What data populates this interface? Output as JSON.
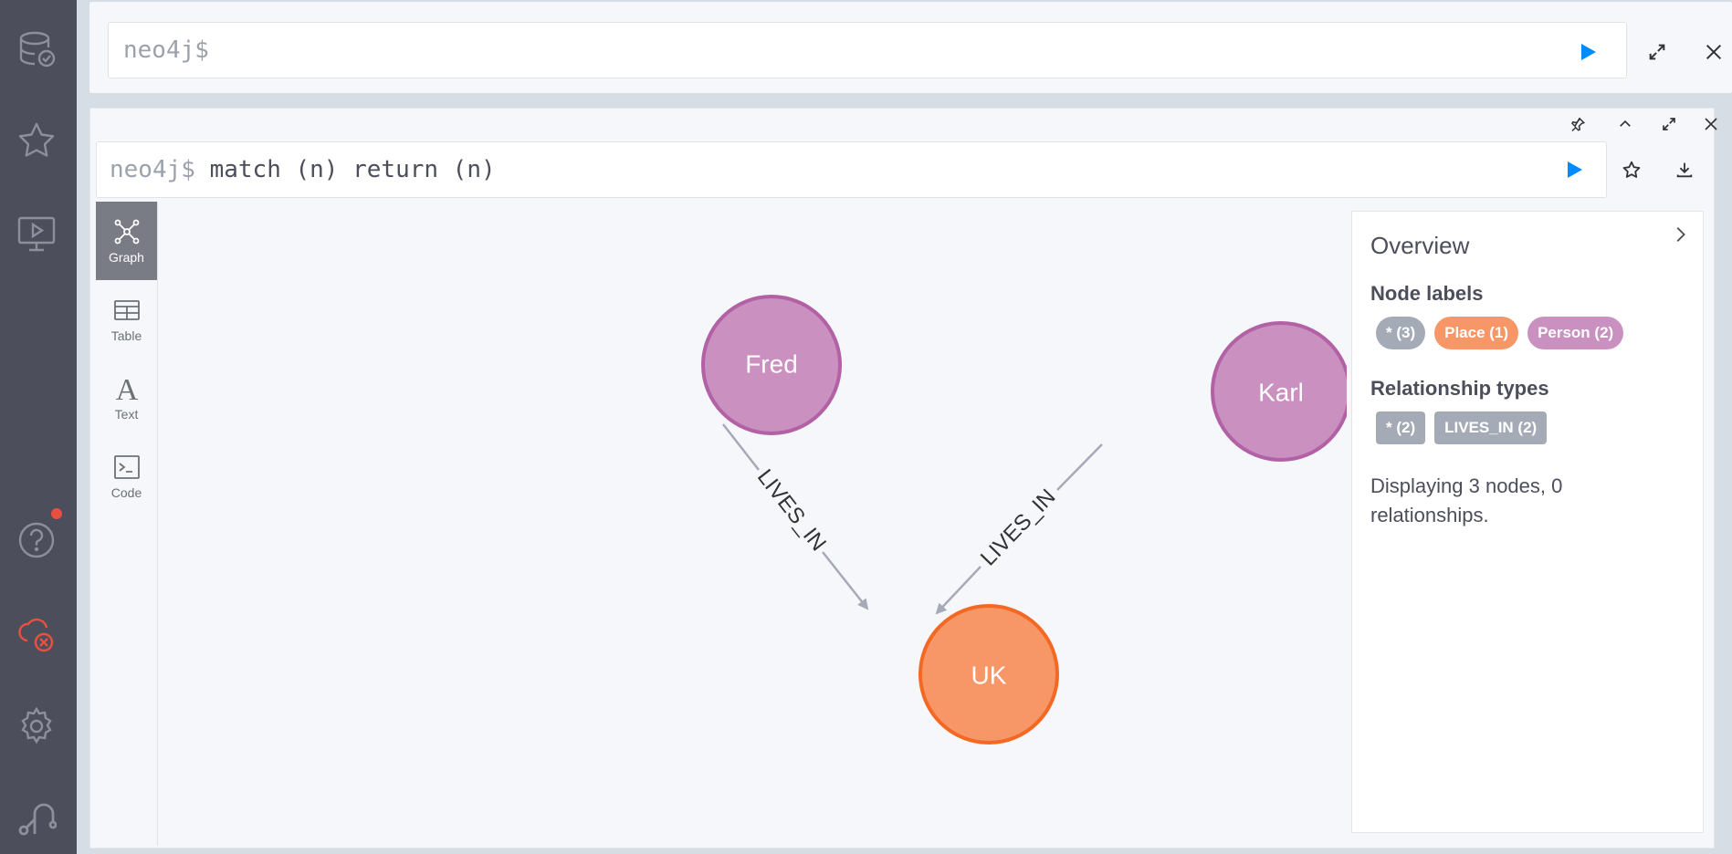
{
  "sidebar": {
    "items": [
      "database-icon",
      "favorites-icon",
      "guides-icon",
      "help-icon",
      "connection-error-icon",
      "settings-icon",
      "about-icon"
    ]
  },
  "editor": {
    "prompt": "neo4j$"
  },
  "frame": {
    "prompt": "neo4j$",
    "query": " match (n) return (n)",
    "tabs": [
      {
        "label": "Graph",
        "icon": "graph-icon"
      },
      {
        "label": "Table",
        "icon": "table-icon"
      },
      {
        "label": "Text",
        "icon": "text-icon"
      },
      {
        "label": "Code",
        "icon": "code-icon"
      }
    ]
  },
  "graph": {
    "nodes": {
      "fred": {
        "label": "Fred",
        "type": "Person"
      },
      "karl": {
        "label": "Karl",
        "type": "Person"
      },
      "uk": {
        "label": "UK",
        "type": "Place"
      }
    },
    "relationships": [
      {
        "from": "Fred",
        "to": "UK",
        "type": "LIVES_IN"
      },
      {
        "from": "Karl",
        "to": "UK",
        "type": "LIVES_IN"
      }
    ],
    "colors": {
      "person_fill": "#c990c0",
      "person_stroke": "#b261a5",
      "place_fill": "#f79767",
      "place_stroke": "#f36924",
      "edge": "#a5abb6"
    }
  },
  "overview": {
    "title": "Overview",
    "node_labels_heading": "Node labels",
    "node_labels": [
      {
        "text": "* (3)",
        "color": "#a5abb6"
      },
      {
        "text": "Place (1)",
        "color": "#f79767"
      },
      {
        "text": "Person (2)",
        "color": "#c990c0"
      }
    ],
    "rel_types_heading": "Relationship types",
    "rel_types": [
      {
        "text": "* (2)",
        "color": "#a5abb6"
      },
      {
        "text": "LIVES_IN (2)",
        "color": "#a5abb6"
      }
    ],
    "summary": "Displaying 3 nodes, 0 relationships."
  }
}
